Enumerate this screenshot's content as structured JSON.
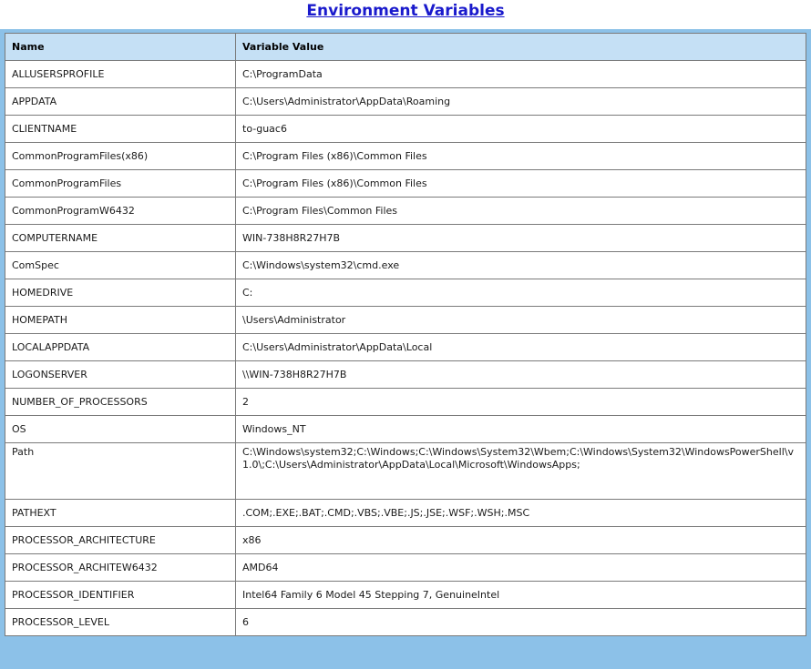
{
  "page": {
    "title": "Environment Variables"
  },
  "table": {
    "columns": [
      "Name",
      "Variable Value"
    ],
    "rows": [
      {
        "name": "ALLUSERSPROFILE",
        "value": "C:\\ProgramData"
      },
      {
        "name": "APPDATA",
        "value": "C:\\Users\\Administrator\\AppData\\Roaming"
      },
      {
        "name": "CLIENTNAME",
        "value": "to-guac6"
      },
      {
        "name": "CommonProgramFiles(x86)",
        "value": "C:\\Program Files (x86)\\Common Files"
      },
      {
        "name": "CommonProgramFiles",
        "value": "C:\\Program Files (x86)\\Common Files"
      },
      {
        "name": "CommonProgramW6432",
        "value": "C:\\Program Files\\Common Files"
      },
      {
        "name": "COMPUTERNAME",
        "value": "WIN-738H8R27H7B"
      },
      {
        "name": "ComSpec",
        "value": "C:\\Windows\\system32\\cmd.exe"
      },
      {
        "name": "HOMEDRIVE",
        "value": "C:"
      },
      {
        "name": "HOMEPATH",
        "value": "\\Users\\Administrator"
      },
      {
        "name": "LOCALAPPDATA",
        "value": "C:\\Users\\Administrator\\AppData\\Local"
      },
      {
        "name": "LOGONSERVER",
        "value": "\\\\WIN-738H8R27H7B"
      },
      {
        "name": "NUMBER_OF_PROCESSORS",
        "value": "2"
      },
      {
        "name": "OS",
        "value": "Windows_NT"
      },
      {
        "name": "Path",
        "value": "C:\\Windows\\system32;C:\\Windows;C:\\Windows\\System32\\Wbem;C:\\Windows\\System32\\WindowsPowerShell\\v1.0\\;C:\\Users\\Administrator\\AppData\\Local\\Microsoft\\WindowsApps;"
      },
      {
        "name": "PATHEXT",
        "value": ".COM;.EXE;.BAT;.CMD;.VBS;.VBE;.JS;.JSE;.WSF;.WSH;.MSC"
      },
      {
        "name": "PROCESSOR_ARCHITECTURE",
        "value": "x86"
      },
      {
        "name": "PROCESSOR_ARCHITEW6432",
        "value": "AMD64"
      },
      {
        "name": "PROCESSOR_IDENTIFIER",
        "value": "Intel64 Family 6 Model 45 Stepping 7, GenuineIntel"
      },
      {
        "name": "PROCESSOR_LEVEL",
        "value": "6"
      }
    ]
  },
  "colors": {
    "title_link": "#1a1acc",
    "frame": "#8cc1e8",
    "header_bg": "#c5e0f5",
    "border": "#7a7a7a"
  }
}
